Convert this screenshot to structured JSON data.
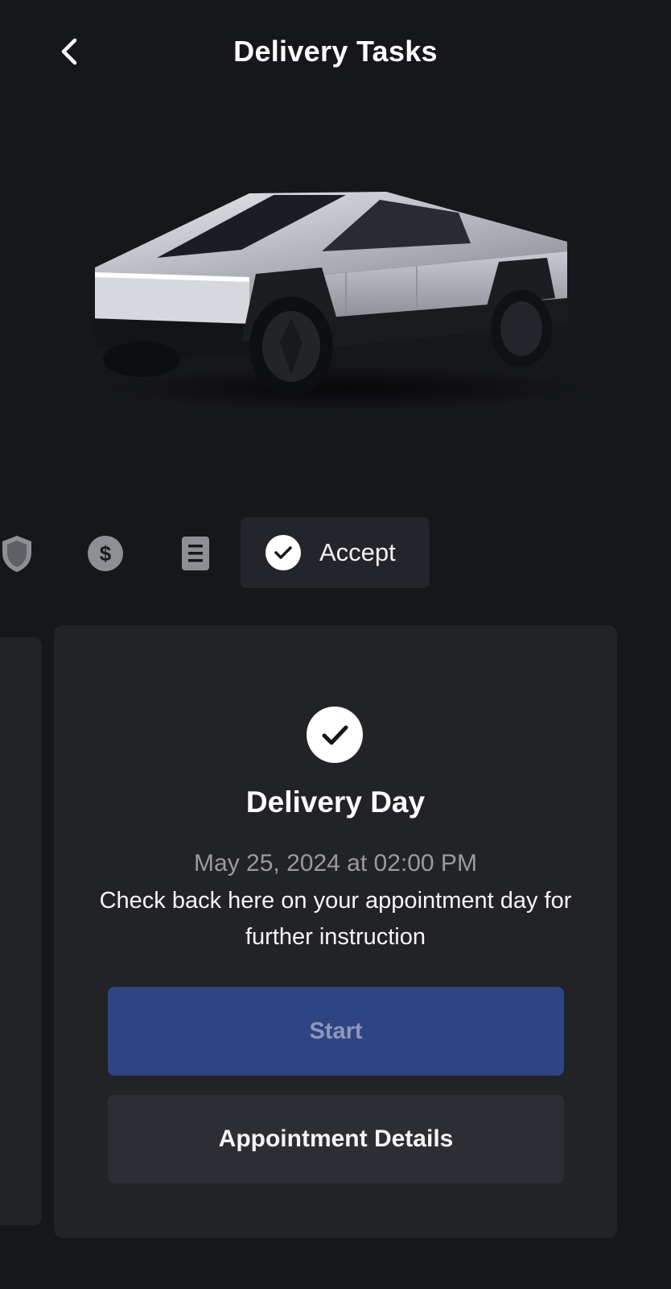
{
  "header": {
    "title": "Delivery Tasks",
    "back_icon": "chevron-left-icon"
  },
  "vehicle": {
    "image": "cybertruck-image"
  },
  "steps": {
    "items": [
      {
        "icon": "shield-icon",
        "state": "inactive"
      },
      {
        "icon": "dollar-icon",
        "state": "inactive"
      },
      {
        "icon": "document-icon",
        "state": "inactive"
      },
      {
        "icon": "check-circle-icon",
        "label": "Accept",
        "state": "active"
      }
    ]
  },
  "card": {
    "icon": "check-circle-icon",
    "title": "Delivery Day",
    "date": "May 25, 2024 at 02:00 PM",
    "body": "Check back here on your appointment day for further instruction",
    "start_label": "Start",
    "details_label": "Appointment Details"
  },
  "colors": {
    "background": "#16171a",
    "card": "#222327",
    "primary_button": "#2f4482",
    "secondary_button": "#2d2e33",
    "muted_text": "#9a9ba0"
  }
}
